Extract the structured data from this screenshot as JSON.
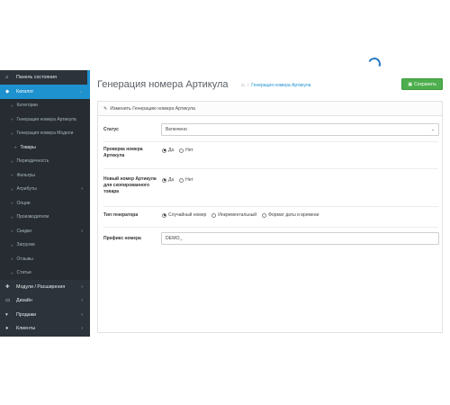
{
  "sidebar": {
    "items": [
      {
        "label": "Панель состояния",
        "icon": "home-icon"
      },
      {
        "label": "Каталог",
        "icon": "tag-icon"
      }
    ],
    "catalog_sub": [
      {
        "label": "Категории"
      },
      {
        "label": "Генерация номера Артикула"
      },
      {
        "label": "Генерация номера Модели"
      },
      {
        "label": "Товары"
      },
      {
        "label": "Периодичность"
      },
      {
        "label": "Фильтры"
      },
      {
        "label": "Атрибуты"
      },
      {
        "label": "Опции"
      },
      {
        "label": "Производители"
      },
      {
        "label": "Скидки"
      },
      {
        "label": "Загрузки"
      },
      {
        "label": "Отзывы"
      },
      {
        "label": "Статьи"
      }
    ],
    "bottom": [
      {
        "label": "Модули / Расширения",
        "icon": "puzzle-icon"
      },
      {
        "label": "Дизайн",
        "icon": "monitor-icon"
      },
      {
        "label": "Продажи",
        "icon": "cart-icon"
      },
      {
        "label": "Клиенты",
        "icon": "user-icon"
      }
    ]
  },
  "header": {
    "title": "Генерация номера Артикула",
    "breadcrumb": "Генерация номера Артикула",
    "save_label": "Сохранить"
  },
  "panel": {
    "title": "Изменить Генерацию номера Артикула"
  },
  "form": {
    "status": {
      "label": "Статус",
      "value": "Включено"
    },
    "check": {
      "label": "Проверка номера Артикула",
      "yes": "Да",
      "no": "Нет",
      "selected": "yes"
    },
    "new_number": {
      "label": "Новый номер Артикула для скопированного товара",
      "yes": "Да",
      "no": "Нет",
      "selected": "yes"
    },
    "generator": {
      "label": "Тип генератора",
      "options": [
        "Случайный номер",
        "Инкрементальный",
        "Формат даты и времени"
      ],
      "selected": 0
    },
    "prefix": {
      "label": "Префикс номера",
      "value": "DEMO_"
    }
  }
}
